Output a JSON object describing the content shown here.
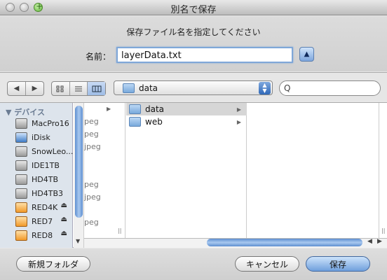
{
  "window": {
    "title": "別名で保存"
  },
  "dialog": {
    "subtitle": "保存ファイル名を指定してください",
    "name_label": "名前：",
    "filename": "layerData.txt"
  },
  "toolbar": {
    "back_glyph": "◀",
    "forward_glyph": "▶",
    "view_icons": [
      "icon-view-icon",
      "list-view-icon",
      "column-view-icon"
    ],
    "location": "data",
    "search_placeholder": "",
    "search_glyph": "Q"
  },
  "sidebar": {
    "section_label": "▼ デバイス",
    "devices": [
      {
        "label": "MacPro16",
        "icon": "hard-drive-icon",
        "eject": false
      },
      {
        "label": "iDisk",
        "icon": "idisk-icon",
        "eject": false
      },
      {
        "label": "SnowLeo...",
        "icon": "hard-drive-icon",
        "eject": false
      },
      {
        "label": "IDE1TB",
        "icon": "hard-drive-icon",
        "eject": false
      },
      {
        "label": "HD4TB",
        "icon": "hard-drive-icon",
        "eject": false
      },
      {
        "label": "HD4TB3",
        "icon": "hard-drive-icon",
        "eject": false
      },
      {
        "label": "RED4K",
        "icon": "external-drive-icon",
        "eject": true
      },
      {
        "label": "RED7",
        "icon": "external-drive-icon",
        "eject": true
      },
      {
        "label": "RED8",
        "icon": "external-drive-icon",
        "eject": true
      }
    ],
    "eject_glyph": "⏏"
  },
  "browser": {
    "ghost_items": [
      "peg",
      "peg",
      "jpeg",
      "",
      "",
      "peg",
      "jpeg",
      "",
      "peg"
    ],
    "column_items": [
      {
        "label": "data",
        "selected": true
      },
      {
        "label": "web",
        "selected": false
      }
    ],
    "arrow_glyph": "▶",
    "resize_glyph": "||"
  },
  "buttons": {
    "new_folder": "新規フォルダ",
    "cancel": "キャンセル",
    "save": "保存"
  }
}
